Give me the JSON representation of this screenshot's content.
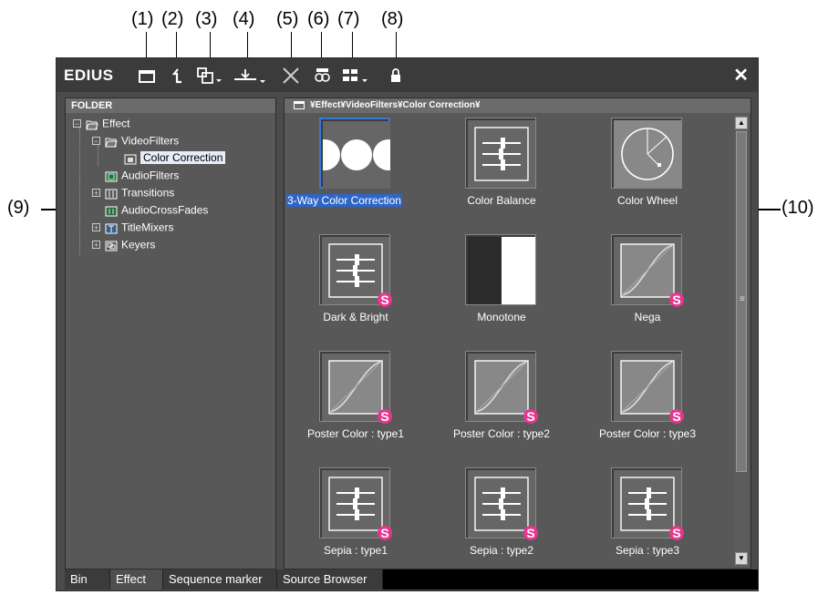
{
  "callouts": {
    "top": [
      "(1)",
      "(2)",
      "(3)",
      "(4)",
      "(5)",
      "(6)",
      "(7)",
      "(8)"
    ],
    "left": "(9)",
    "right": "(10)"
  },
  "window": {
    "title": "EDIUS",
    "toolbar_icons": [
      "new-folder-icon",
      "up-folder-icon",
      "copy-icon",
      "import-icon",
      "delete-icon",
      "property-icon",
      "view-mode-icon",
      "lock-icon"
    ],
    "close_glyph": "✕"
  },
  "folder_pane": {
    "header": "FOLDER",
    "tree": [
      {
        "label": "Effect",
        "expander": "−",
        "icon": "open-folder-icon"
      },
      {
        "label": "VideoFilters",
        "expander": "−",
        "icon": "open-folder-icon"
      },
      {
        "label": "Color Correction",
        "icon": "effect-folder-icon",
        "selected": true
      },
      {
        "label": "AudioFilters",
        "icon": "audio-filter-folder-icon"
      },
      {
        "label": "Transitions",
        "expander": "+",
        "icon": "transition-folder-icon"
      },
      {
        "label": "AudioCrossFades",
        "icon": "audio-crossfade-folder-icon"
      },
      {
        "label": "TitleMixers",
        "expander": "+",
        "icon": "title-mixer-folder-icon"
      },
      {
        "label": "Keyers",
        "expander": "+",
        "icon": "keyer-folder-icon"
      }
    ]
  },
  "content_pane": {
    "breadcrumb": "¥Effect¥VideoFilters¥Color Correction¥",
    "items": [
      {
        "label": "3-Way Color Correction",
        "thumb": "three-circles",
        "selected": true
      },
      {
        "label": "Color Balance",
        "thumb": "sliders"
      },
      {
        "label": "Color Wheel",
        "thumb": "wheel"
      },
      {
        "label": "Dark & Bright",
        "thumb": "sliders",
        "badge": "S"
      },
      {
        "label": "Monotone",
        "thumb": "monotone"
      },
      {
        "label": "Nega",
        "thumb": "curve",
        "badge": "S"
      },
      {
        "label": "Poster Color : type1",
        "thumb": "curve",
        "badge": "S"
      },
      {
        "label": "Poster Color : type2",
        "thumb": "curve",
        "badge": "S"
      },
      {
        "label": "Poster Color : type3",
        "thumb": "curve",
        "badge": "S"
      },
      {
        "label": "Sepia : type1",
        "thumb": "sliders",
        "badge": "S"
      },
      {
        "label": "Sepia : type2",
        "thumb": "sliders",
        "badge": "S"
      },
      {
        "label": "Sepia : type3",
        "thumb": "sliders",
        "badge": "S"
      }
    ]
  },
  "tabs": [
    {
      "label": "Bin",
      "active": false
    },
    {
      "label": "Effect",
      "active": true
    },
    {
      "label": "Sequence marker",
      "active": false
    },
    {
      "label": "Source Browser",
      "active": false
    }
  ],
  "colors": {
    "accent": "#3a78d8",
    "badge": "#e8358f"
  }
}
